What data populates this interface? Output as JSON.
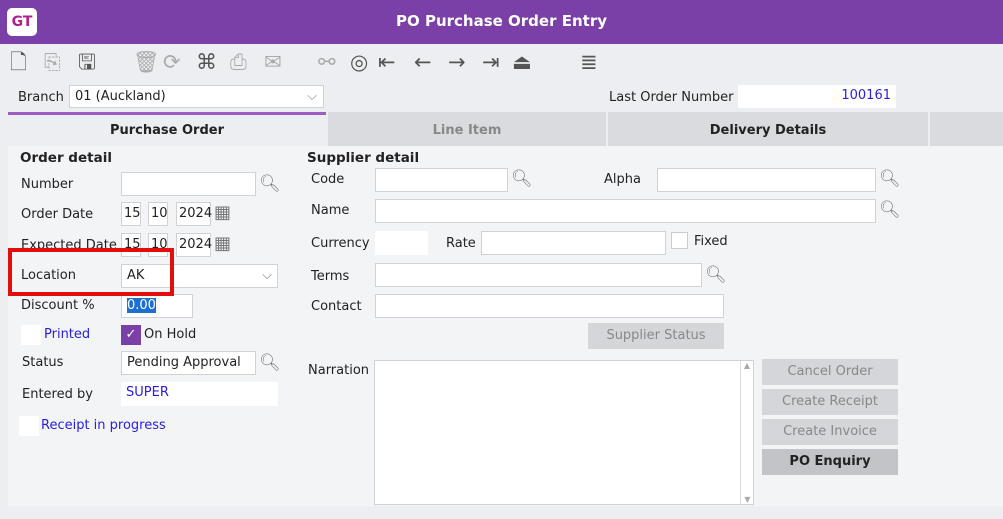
{
  "app": {
    "logo": "GT",
    "title": "PO Purchase Order Entry"
  },
  "toolbar": [
    {
      "icon": "new-document-icon",
      "glyph": "🗋",
      "enabled": true
    },
    {
      "icon": "copy-icon",
      "glyph": "⎘",
      "enabled": false
    },
    {
      "icon": "save-icon",
      "glyph": "🖫",
      "enabled": true
    },
    {
      "icon": "delete-icon",
      "glyph": "🗑",
      "enabled": false
    },
    {
      "icon": "refresh-icon",
      "glyph": "⟳",
      "enabled": false
    },
    {
      "icon": "workflow-icon",
      "glyph": "⌘",
      "enabled": true
    },
    {
      "icon": "print-icon",
      "glyph": "⎙",
      "enabled": false
    },
    {
      "icon": "email-icon",
      "glyph": "✉",
      "enabled": false
    },
    {
      "icon": "binoculars-icon",
      "glyph": "⚯",
      "enabled": false
    },
    {
      "icon": "compass-icon",
      "glyph": "◎",
      "enabled": true
    },
    {
      "icon": "first-record-icon",
      "glyph": "⇤",
      "enabled": true
    },
    {
      "icon": "previous-record-icon",
      "glyph": "←",
      "enabled": true
    },
    {
      "icon": "next-record-icon",
      "glyph": "→",
      "enabled": true
    },
    {
      "icon": "last-record-icon",
      "glyph": "⇥",
      "enabled": true
    },
    {
      "icon": "exit-icon",
      "glyph": "⏏",
      "enabled": true
    },
    {
      "icon": "list-icon",
      "glyph": "≣",
      "enabled": true
    }
  ],
  "branch": {
    "label": "Branch",
    "value": "01  (Auckland)"
  },
  "last_order": {
    "label": "Last Order Number",
    "value": "100161"
  },
  "tabs": [
    "Purchase Order",
    "Line Item",
    "Delivery Details"
  ],
  "order": {
    "heading": "Order detail",
    "number_label": "Number",
    "number": "",
    "order_date_label": "Order Date",
    "od": [
      "15",
      "10",
      "2024"
    ],
    "expected_date_label": "Expected Date",
    "ed": [
      "15",
      "10",
      "2024"
    ],
    "location_label": "Location",
    "location": "AK",
    "discount_label": "Discount %",
    "discount": "0.00",
    "printed_label": "Printed",
    "printed": false,
    "on_hold_label": "On Hold",
    "on_hold": true,
    "status_label": "Status",
    "status": "Pending Approval",
    "entered_label": "Entered by",
    "entered": "SUPER",
    "receipt_label": "Receipt in progress",
    "receipt": false
  },
  "supplier": {
    "heading": "Supplier detail",
    "code_label": "Code",
    "code": "",
    "alpha_label": "Alpha",
    "alpha": "",
    "name_label": "Name",
    "name": "",
    "currency_label": "Currency",
    "currency": "",
    "rate_label": "Rate",
    "rate": "",
    "fixed_label": "Fixed",
    "fixed": false,
    "terms_label": "Terms",
    "terms": "",
    "contact_label": "Contact",
    "contact": "",
    "status_button": "Supplier Status",
    "narration_label": "Narration",
    "narration": ""
  },
  "actions": [
    "Cancel Order",
    "Create Receipt",
    "Create Invoice",
    "PO Enquiry"
  ],
  "colors": {
    "accent": "#7b3fa8",
    "highlight": "#e20d0d",
    "link": "#2b20e0"
  }
}
